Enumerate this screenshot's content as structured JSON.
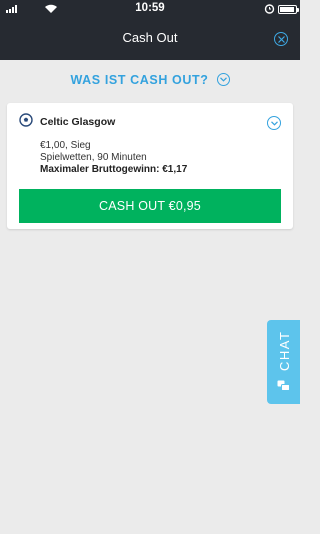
{
  "status_bar": {
    "time": "10:59",
    "battery_level": 0.92
  },
  "header": {
    "title": "Cash Out"
  },
  "info_link": {
    "label": "WAS IST CASH OUT?"
  },
  "bet_card": {
    "team": "Celtic Glasgow",
    "stake_line": "€1,00, Sieg",
    "market_line": "Spielwetten, 90 Minuten",
    "max_win_line": "Maximaler Bruttogewinn: €1,17",
    "cashout_button": "CASH OUT €0,95"
  },
  "chat": {
    "label": "CHAT"
  },
  "colors": {
    "header_bg": "#262a31",
    "accent_blue": "#33a2de",
    "cashout_green": "#00b25e",
    "chat_tab": "#5dc4ec",
    "page_bg": "#ebebeb"
  }
}
